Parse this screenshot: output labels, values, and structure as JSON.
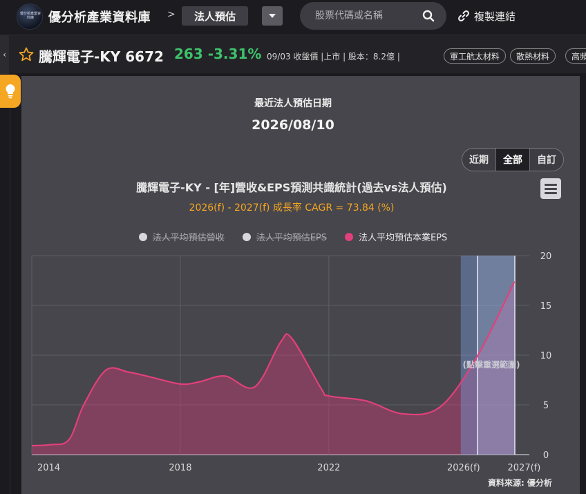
{
  "header": {
    "site_title": "優分析產業資料庫",
    "logo_text": "優分析產業資料庫",
    "crumb_separator": ">",
    "section": "法人預估",
    "search_placeholder": "股票代碼或名稱",
    "copy_link": "複製連結"
  },
  "stock": {
    "name": "騰輝電子-KY 6672",
    "price_change": "263 -3.31%",
    "meta": "09/03 收盤價 |上市 | 股本：8.2億 |",
    "tags": [
      "軍工航太材料",
      "散熱材料",
      "高頻"
    ],
    "price_color": "#3ec26b"
  },
  "panel": {
    "recent_label": "最近法人預估日期",
    "recent_date": "2026/08/10",
    "range_buttons": [
      "近期",
      "全部",
      "自訂"
    ],
    "active_range": "全部",
    "source": "資料來源: 優分析"
  },
  "chart_data": {
    "type": "area",
    "title": "騰輝電子-KY - [年]營收&EPS預測共識統計(過去vs法人預估)",
    "subtitle": "2026(f) - 2027(f) 成長率 CAGR = 73.84 (%)",
    "legend": [
      {
        "name": "法人平均預估營收",
        "visible": false,
        "color": "#d8d8dc"
      },
      {
        "name": "法人平均預估EPS",
        "visible": false,
        "color": "#d8d8dc"
      },
      {
        "name": "法人平均預估本業EPS",
        "visible": true,
        "color": "#e2407a"
      }
    ],
    "x_ticks": [
      "2014",
      "2018",
      "2022",
      "2026(f)",
      "2027(f)"
    ],
    "y_ticks": [
      0,
      5,
      10,
      15,
      20
    ],
    "ylim": [
      0,
      20
    ],
    "xlim": [
      2014,
      2027.4
    ],
    "grid": true,
    "forecast_band": [
      2026,
      2027
    ],
    "forecast_band_label": "(點擊重選範圍)",
    "series": [
      {
        "name": "法人平均預估本業EPS",
        "x": [
          2014,
          2014.5,
          2015,
          2015.4,
          2016,
          2016.6,
          2017.2,
          2018,
          2018.5,
          2019.2,
          2020,
          2020.7,
          2021,
          2021.8,
          2022,
          2023,
          2024,
          2025,
          2026,
          2027
        ],
        "values": [
          0.9,
          1.0,
          1.5,
          5.0,
          8.5,
          8.3,
          7.8,
          7.1,
          7.3,
          7.9,
          6.8,
          11.3,
          11.7,
          6.6,
          5.9,
          5.4,
          4.1,
          4.8,
          9.9,
          17.4
        ]
      }
    ]
  }
}
